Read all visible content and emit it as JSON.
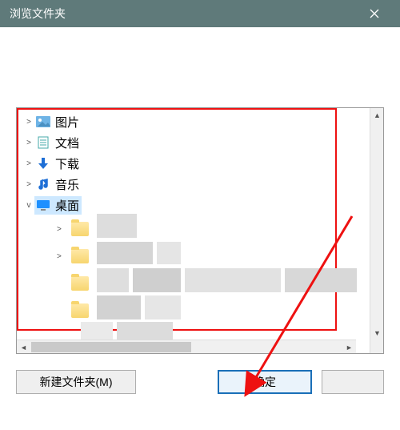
{
  "title": "浏览文件夹",
  "tree": {
    "items": [
      {
        "label": "图片",
        "icon": "pictures-icon",
        "expander": ">"
      },
      {
        "label": "文档",
        "icon": "documents-icon",
        "expander": ">"
      },
      {
        "label": "下载",
        "icon": "downloads-icon",
        "expander": ">"
      },
      {
        "label": "音乐",
        "icon": "music-icon",
        "expander": ">"
      },
      {
        "label": "桌面",
        "icon": "desktop-icon",
        "expander": "v",
        "selected": true
      }
    ],
    "sub_expanders": [
      ">",
      ">"
    ]
  },
  "buttons": {
    "new_folder": "新建文件夹(M)",
    "ok": "确定",
    "cancel": ""
  }
}
